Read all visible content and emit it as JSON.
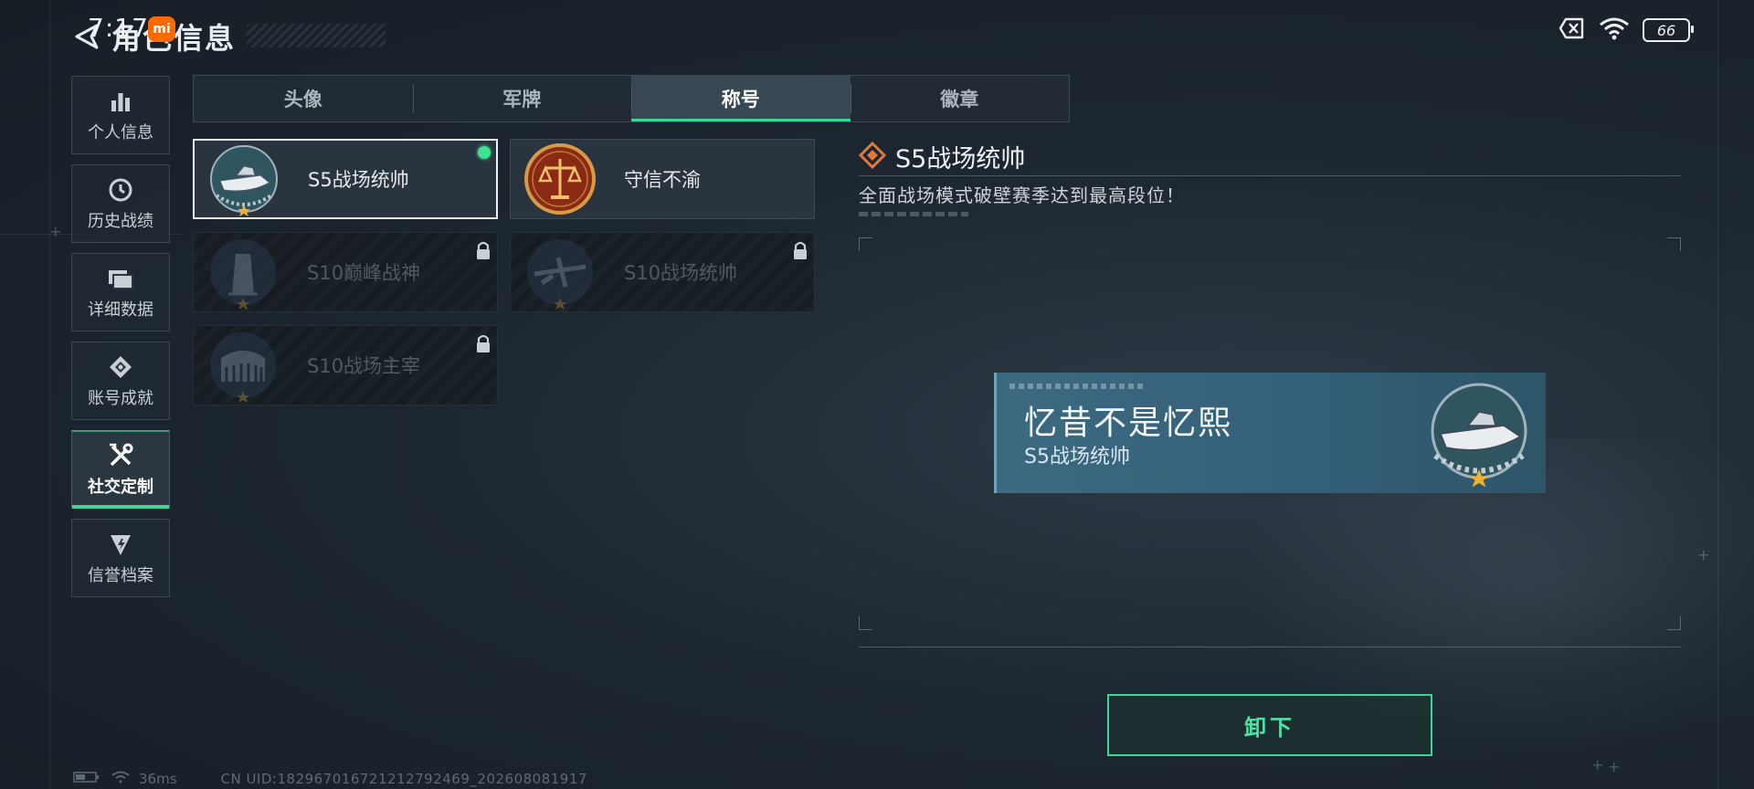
{
  "status_bar": {
    "time": "7:17",
    "badge": "mi",
    "battery": "66"
  },
  "header": {
    "title": "角色信息"
  },
  "nav": [
    {
      "label": "个人信息",
      "icon": "bar-chart-icon"
    },
    {
      "label": "历史战绩",
      "icon": "clock-icon"
    },
    {
      "label": "详细数据",
      "icon": "folder-icon"
    },
    {
      "label": "账号成就",
      "icon": "achievement-icon"
    },
    {
      "label": "社交定制",
      "icon": "tools-icon",
      "active": true
    },
    {
      "label": "信誉档案",
      "icon": "shield-icon"
    }
  ],
  "tabs": [
    {
      "label": "头像"
    },
    {
      "label": "军牌"
    },
    {
      "label": "称号",
      "active": true
    },
    {
      "label": "徽章"
    }
  ],
  "titles": [
    {
      "label": "S5战场统帅",
      "state": "selected",
      "medal": "boat-medal"
    },
    {
      "label": "守信不渝",
      "state": "unlocked",
      "medal": "scales-medal"
    },
    {
      "label": "S10巅峰战神",
      "state": "locked",
      "medal": "tower-medal"
    },
    {
      "label": "S10战场统帅",
      "state": "locked",
      "medal": "plane-medal"
    },
    {
      "label": "S10战场主宰",
      "state": "locked",
      "medal": "colosseum-medal"
    }
  ],
  "detail": {
    "title": "S5战场统帅",
    "description": "全面战场模式破壁赛季达到最高段位！"
  },
  "preview": {
    "player_name": "忆昔不是忆熙",
    "title": "S5战场统帅"
  },
  "actions": {
    "unequip_label": "卸下"
  },
  "footer": {
    "ping": "36ms",
    "uid": "CN UID:1829670167212127924​69_202608081917"
  },
  "colors": {
    "accent": "#3fd49a",
    "plate": "#3c6a80",
    "orange": "#e07a3a"
  }
}
